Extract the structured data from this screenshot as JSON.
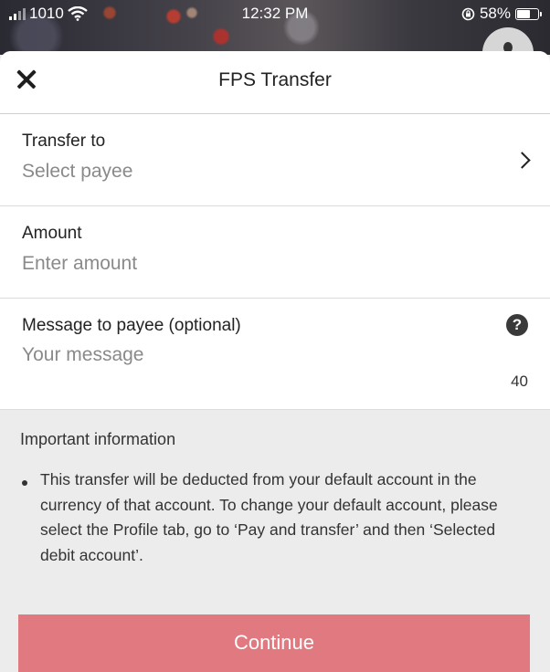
{
  "status_bar": {
    "carrier": "1010",
    "time": "12:32 PM",
    "battery": "58%"
  },
  "header": {
    "title": "FPS Transfer"
  },
  "fields": {
    "transfer_to": {
      "label": "Transfer to",
      "placeholder": "Select payee"
    },
    "amount": {
      "label": "Amount",
      "placeholder": "Enter amount"
    },
    "message": {
      "label": "Message to payee (optional)",
      "placeholder": "Your message",
      "remaining": "40",
      "help": "?"
    }
  },
  "info": {
    "title": "Important information",
    "bullet": "This transfer will be deducted from your default account in the currency of that account. To change your default account, please select the Profile tab, go to ‘Pay and transfer’ and then ‘Selected debit account’."
  },
  "actions": {
    "continue_label": "Continue"
  },
  "colors": {
    "continue_button": "#e07a80"
  }
}
